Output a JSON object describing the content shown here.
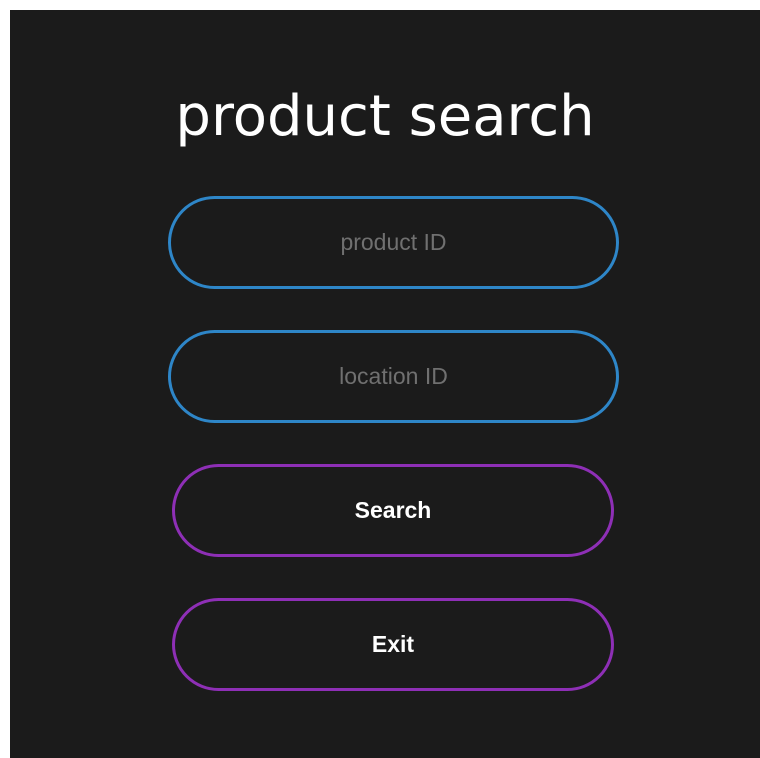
{
  "page": {
    "title": "product search",
    "colors": {
      "background": "#1b1b1b",
      "input_border": "#2e86c8",
      "button_border": "#8e2fb6",
      "title_text": "#ffffff",
      "placeholder_text": "#707070"
    }
  },
  "form": {
    "product_id": {
      "value": "",
      "placeholder": "product ID"
    },
    "location_id": {
      "value": "",
      "placeholder": "location ID"
    },
    "search_label": "Search",
    "exit_label": "Exit"
  }
}
